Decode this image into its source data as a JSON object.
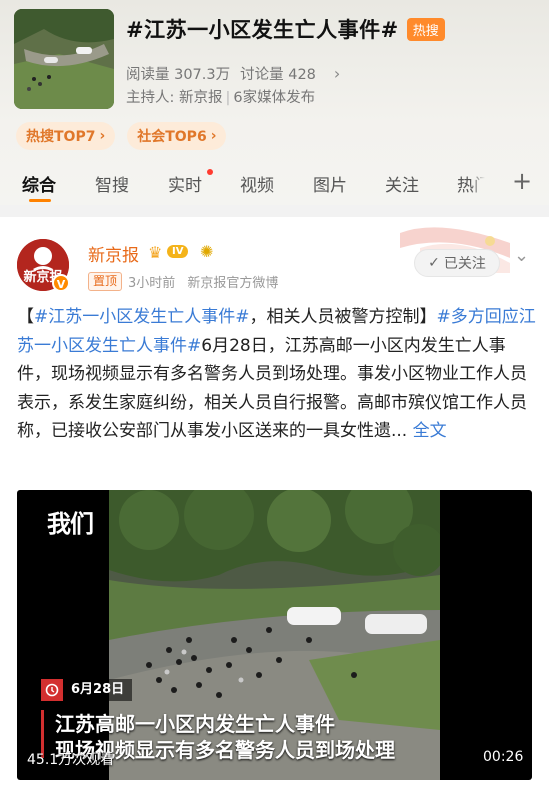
{
  "topic": {
    "title": "#江苏一小区发生亡人事件#",
    "hot_badge": "热搜",
    "read_count": "阅读量 307.3万",
    "discuss_count": "讨论量 428",
    "host_label": "主持人: 新京报",
    "host_extra": "6家媒体发布"
  },
  "ranks": [
    {
      "label": "热搜TOP7"
    },
    {
      "label": "社会TOP6"
    }
  ],
  "tabs": [
    {
      "label": "综合"
    },
    {
      "label": "智搜"
    },
    {
      "label": "实时"
    },
    {
      "label": "视频"
    },
    {
      "label": "图片"
    },
    {
      "label": "关注"
    },
    {
      "label": "热门"
    }
  ],
  "post": {
    "user_name": "新京报",
    "level": "IV",
    "avatar_text": "新京报",
    "pin_tag": "置顶",
    "time": "3小时前",
    "source": "新京报官方微博",
    "follow_label": "已关注",
    "text_open": "【",
    "tag1": "#江苏一小区发生亡人事件#",
    "text_mid": "，相关人员被警方控制】",
    "tag2": "#多方回应江苏一小区发生亡人事件#",
    "body": "6月28日，江苏高邮一小区内发生亡人事件，现场视频显示有多名警务人员到场处理。事发小区物业工作人员表示，系发生家庭纠纷，相关人员自行报警。高邮市殡仪馆工作人员称，已接收公安部门从事发小区送来的一具女性遗...",
    "more": " 全文"
  },
  "video": {
    "brand": "我们",
    "date": "6月28日",
    "caption_line1": "江苏高邮一小区内发生亡人事件",
    "caption_line2": "现场视频显示有多名警务人员到场处理",
    "views": "45.1万次观看",
    "duration": "00:26"
  }
}
